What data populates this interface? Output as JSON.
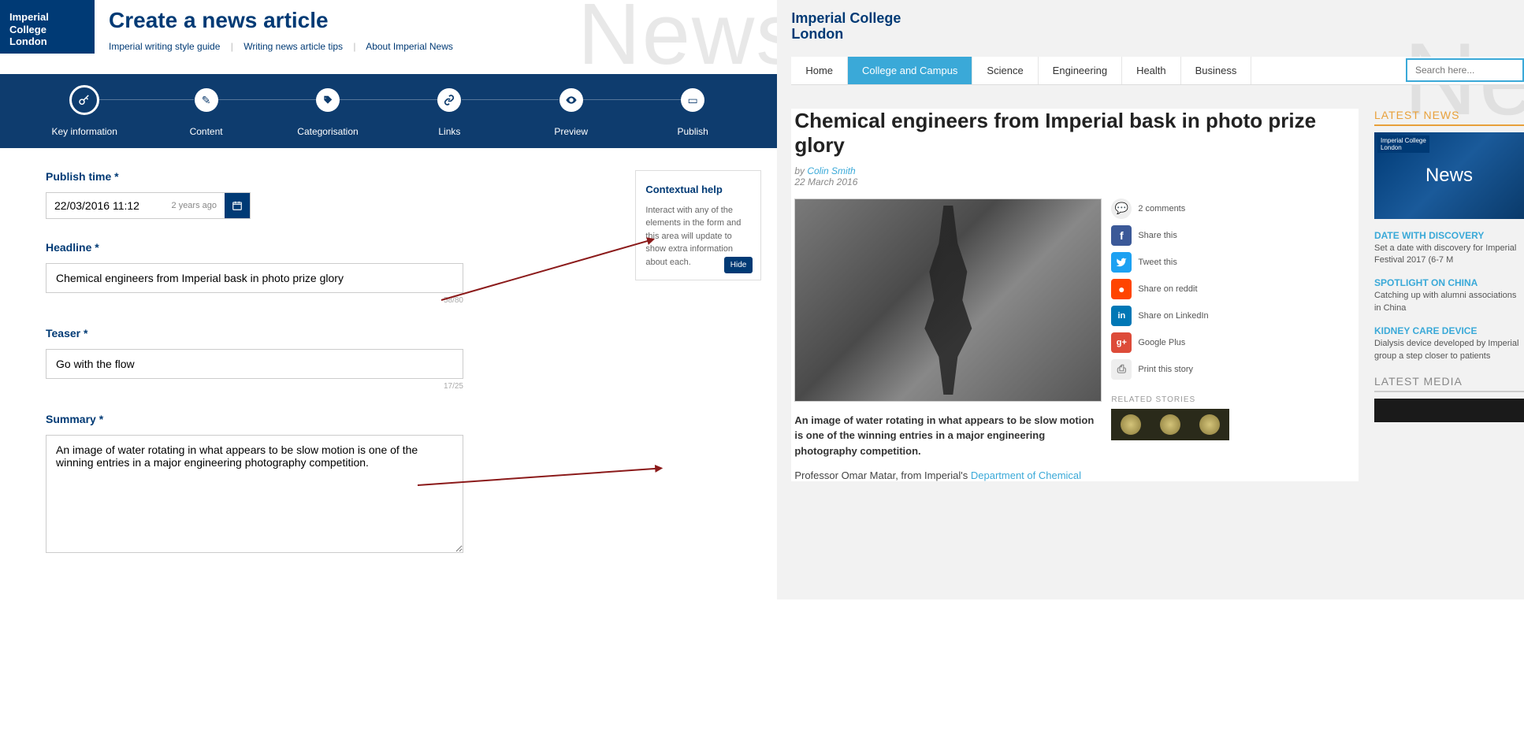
{
  "brand": {
    "name_line1": "Imperial College",
    "name_line2": "London"
  },
  "editor": {
    "page_title": "Create a news article",
    "links": [
      "Imperial writing style guide",
      "Writing news article tips",
      "About Imperial News"
    ],
    "bg_text": "News",
    "wizard": [
      {
        "label": "Key information",
        "active": true,
        "icon": "key-icon"
      },
      {
        "label": "Content",
        "active": false,
        "icon": "pencil-icon"
      },
      {
        "label": "Categorisation",
        "active": false,
        "icon": "tag-icon"
      },
      {
        "label": "Links",
        "active": false,
        "icon": "link-icon"
      },
      {
        "label": "Preview",
        "active": false,
        "icon": "eye-icon"
      },
      {
        "label": "Publish",
        "active": false,
        "icon": "publish-icon"
      }
    ],
    "publish_time": {
      "label": "Publish time",
      "value": "22/03/2016 11:12",
      "ago": "2 years ago"
    },
    "headline": {
      "label": "Headline",
      "value": "Chemical engineers from Imperial bask in photo prize glory",
      "count": "58/80"
    },
    "teaser": {
      "label": "Teaser",
      "value": "Go with the flow",
      "count": "17/25"
    },
    "summary": {
      "label": "Summary",
      "value": "An image of water rotating in what appears to be slow motion is one of the winning entries in a major engineering photography competition."
    },
    "help": {
      "title": "Contextual help",
      "body": "Interact with any of the elements in the form and this area will update to show extra information about each.",
      "hide": "Hide"
    }
  },
  "preview": {
    "bg_text": "News",
    "nav": [
      "Home",
      "College and Campus",
      "Science",
      "Engineering",
      "Health",
      "Business"
    ],
    "nav_active": "College and Campus",
    "search_placeholder": "Search here...",
    "article": {
      "title": "Chemical engineers from Imperial bask in photo prize glory",
      "by_prefix": "by ",
      "author": "Colin Smith",
      "date": "22 March 2016",
      "summary": "An image of water rotating in what appears to be slow motion is one of the winning entries in a major engineering photography competition.",
      "body_prefix": "Professor Omar Matar, from Imperial's ",
      "body_link": "Department of Chemical"
    },
    "share": {
      "comments": {
        "label": "2 comments"
      },
      "items": [
        {
          "label": "Share this",
          "class": "ic-fb",
          "glyph": "f"
        },
        {
          "label": "Tweet this",
          "class": "ic-tw",
          "glyph": "t"
        },
        {
          "label": "Share on reddit",
          "class": "ic-rd",
          "glyph": "r"
        },
        {
          "label": "Share on LinkedIn",
          "class": "ic-li",
          "glyph": "in"
        },
        {
          "label": "Google Plus",
          "class": "ic-gp",
          "glyph": "g+"
        },
        {
          "label": "Print this story",
          "class": "ic-pr",
          "glyph": "⎙"
        }
      ]
    },
    "related_title": "RELATED STORIES",
    "sidebar": {
      "latest_news_title": "LATEST NEWS",
      "thumb_text": "News",
      "items": [
        {
          "title": "DATE WITH DISCOVERY",
          "desc": "Set a date with discovery for Imperial Festival 2017 (6-7 M"
        },
        {
          "title": "SPOTLIGHT ON CHINA",
          "desc": "Catching up with alumni associations in China"
        },
        {
          "title": "KIDNEY CARE DEVICE",
          "desc": "Dialysis device developed by Imperial group a step closer to patients"
        }
      ],
      "latest_media_title": "LATEST MEDIA"
    }
  }
}
